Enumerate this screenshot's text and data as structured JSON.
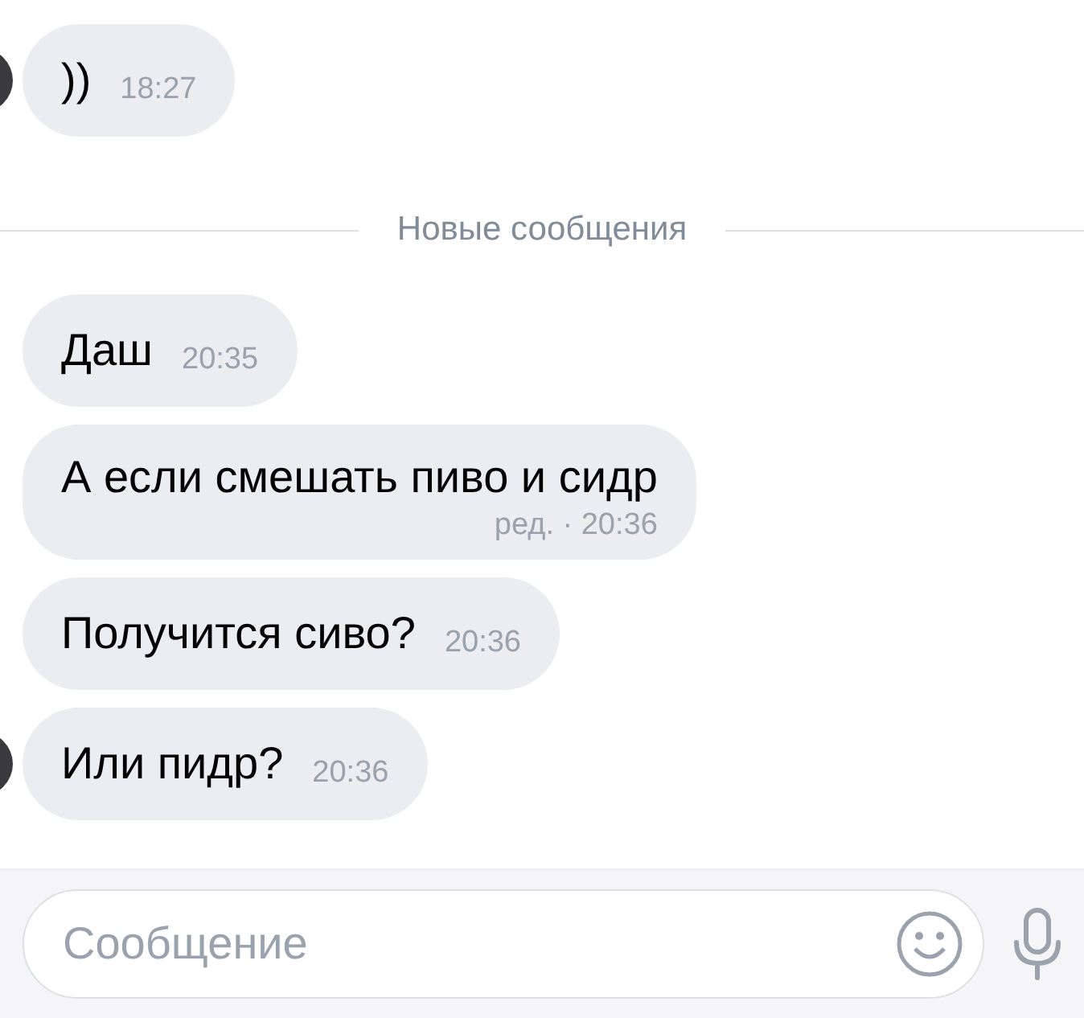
{
  "messages_before": [
    {
      "text": "))",
      "time": "18:27",
      "kind": "inline",
      "avatar": true
    }
  ],
  "divider": {
    "label": "Новые сообщения"
  },
  "messages": [
    {
      "text": "Даш",
      "time": "20:35",
      "kind": "inline",
      "avatar": false
    },
    {
      "text": "А если смешать пиво и сидр",
      "time": "ред. · 20:36",
      "kind": "stacked",
      "avatar": false
    },
    {
      "text": "Получится сиво?",
      "time": "20:36",
      "kind": "inline",
      "avatar": false
    },
    {
      "text": "Или пидр?",
      "time": "20:36",
      "kind": "inline",
      "avatar": true
    }
  ],
  "composer": {
    "placeholder": "Сообщение"
  }
}
